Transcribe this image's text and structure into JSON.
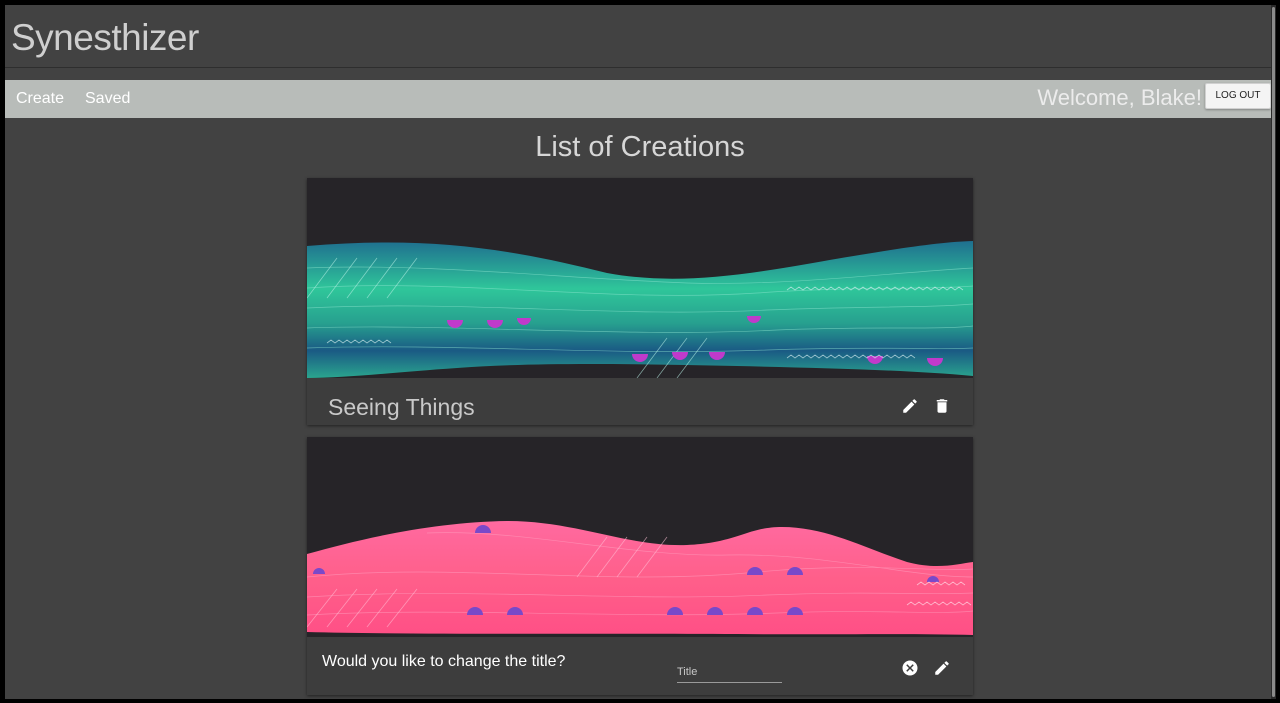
{
  "app": {
    "title": "Synesthizer"
  },
  "nav": {
    "create": "Create",
    "saved": "Saved"
  },
  "user": {
    "welcome": "Welcome, Blake!",
    "logout": "LOG OUT"
  },
  "page": {
    "heading": "List of Creations"
  },
  "creations": [
    {
      "title": "Seeing Things",
      "palette": {
        "sky": "#262428",
        "top": "#1f6f8f",
        "mid": "#2fc69a",
        "bottom": "#1a5a84",
        "dot": "#c03acb"
      },
      "actions": [
        "edit-icon",
        "trash-icon"
      ]
    },
    {
      "palette": {
        "sky": "#262428",
        "top": "#ff5f8a",
        "mid": "#ff6f9c",
        "bottom": "#ff5a7a",
        "dot": "#7a49c9"
      },
      "edit_prompt": "Would you like to change the title?",
      "title_input": {
        "placeholder": "Title",
        "value": ""
      },
      "actions": [
        "cancel-icon",
        "edit-icon"
      ]
    }
  ],
  "colors": {
    "background": "#424242",
    "navbar": "#b8bcb9",
    "card": "#3d3d3d"
  }
}
